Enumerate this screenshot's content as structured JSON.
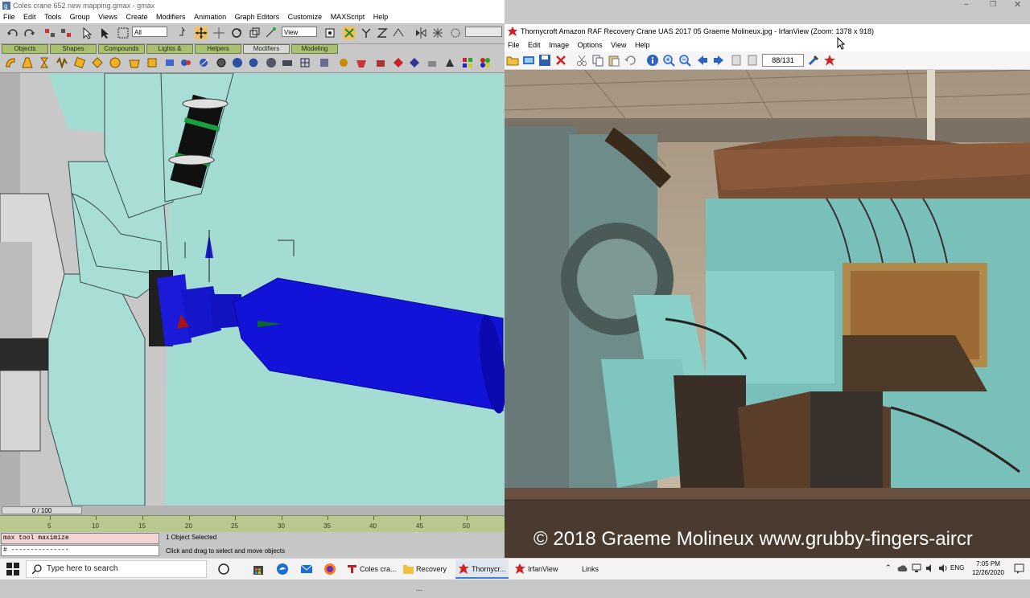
{
  "gmax": {
    "title": "Coles crane 652 new mapping.gmax - gmax",
    "menu": [
      "File",
      "Edit",
      "Tools",
      "Group",
      "Views",
      "Create",
      "Modifiers",
      "Animation",
      "Graph Editors",
      "Customize",
      "MAXScript",
      "Help"
    ],
    "toolbar": {
      "selection_filter": "All",
      "reference_coord": "View"
    },
    "tabs": [
      "Objects",
      "Shapes",
      "Compounds",
      "Lights & Cameras",
      "Helpers",
      "Modifiers",
      "Modeling"
    ],
    "active_tab": "Modifiers",
    "time_slider": "0 / 100",
    "ruler_labels": [
      "5",
      "10",
      "15",
      "20",
      "25",
      "30",
      "35",
      "40",
      "45",
      "50"
    ],
    "script_listener": "max tool maximize",
    "script_input": "# ---------------",
    "status_selected": "1 Object Selected",
    "status_prompt": "Click and drag to select and move objects"
  },
  "irfanview": {
    "title": "Thornycroft Amazon RAF Recovery Crane UAS 2017 05 Graeme Molineux.jpg - IrfanView (Zoom: 1378 x 918)",
    "menu": [
      "File",
      "Edit",
      "Image",
      "Options",
      "View",
      "Help"
    ],
    "page_counter": "88/131",
    "watermark": "© 2018 Graeme Molineux www.grubby-fingers-aircr"
  },
  "taskbar": {
    "search_placeholder": "Type here to search",
    "tasks": [
      {
        "label": "Coles cra...",
        "icon": "gmax-icon"
      },
      {
        "label": "Recovery ...",
        "icon": "folder-icon"
      },
      {
        "label": "Thornycr...",
        "icon": "irfanview-icon"
      },
      {
        "label": "IrfanView",
        "icon": "irfanview-icon"
      },
      {
        "label": "Links",
        "icon": "toolbar"
      }
    ],
    "language": "ENG",
    "time": "7:05 PM",
    "date": "12/26/2020"
  },
  "colors": {
    "viewport": "#a4dcd4",
    "tab_green": "#a8c070",
    "selected_object": "#1212d8",
    "irfan_icon_red": "#d42020"
  }
}
